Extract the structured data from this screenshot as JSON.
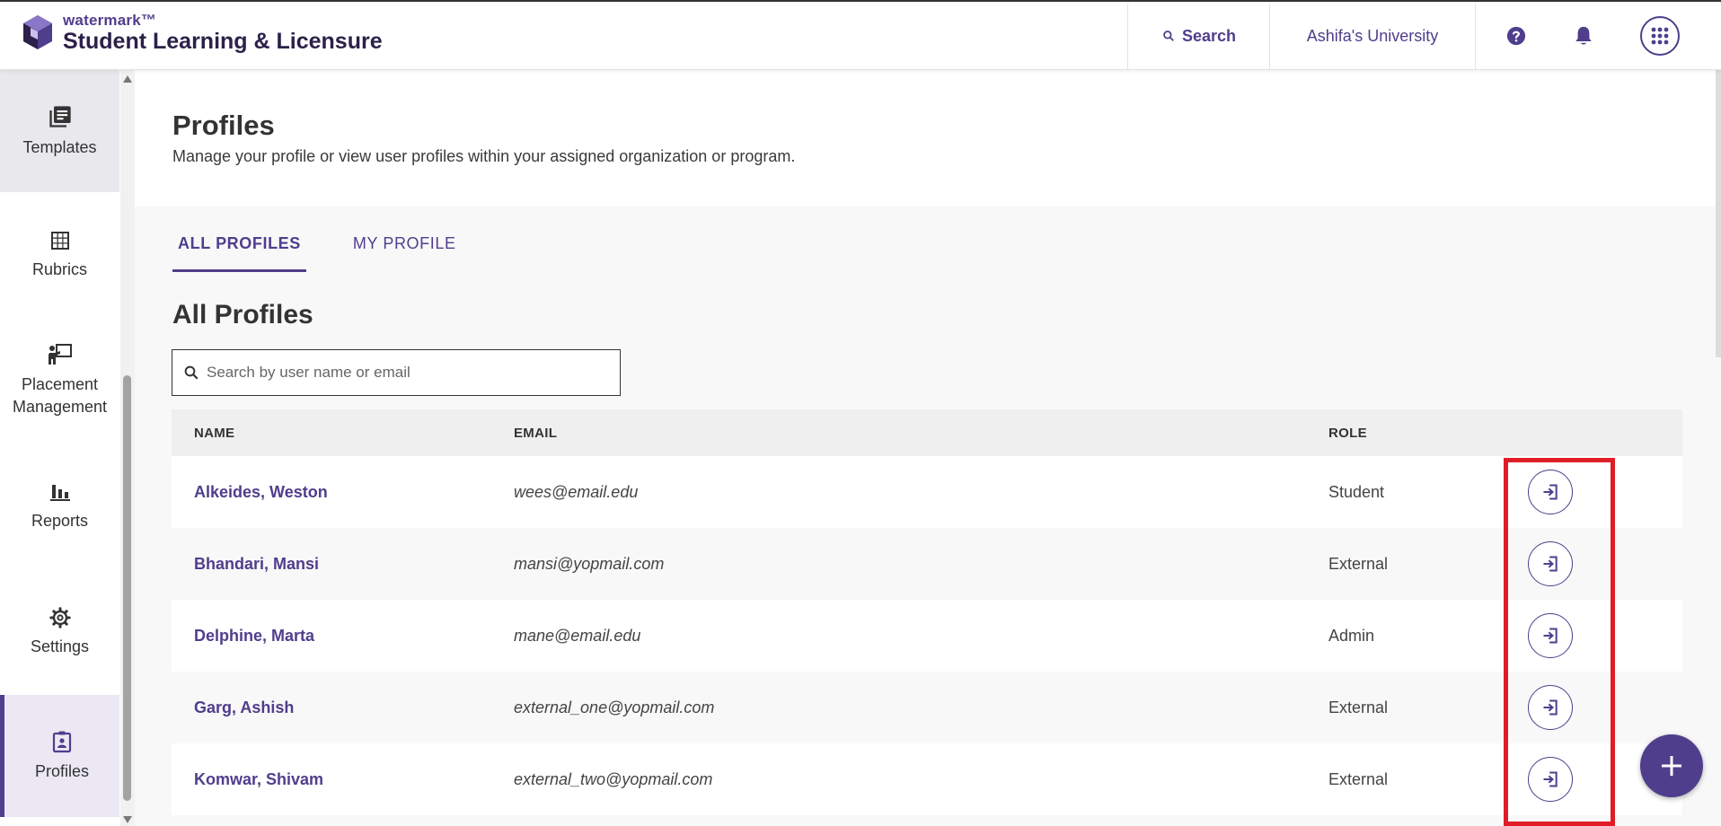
{
  "header": {
    "brand_small": "watermark™",
    "brand_big": "Student Learning & Licensure",
    "search_label": "Search",
    "university": "Ashifa's University",
    "help_icon": "help-circle-icon",
    "bell_icon": "notification-bell-icon",
    "apps_icon": "apps-grid-icon"
  },
  "sidebar": {
    "items": [
      {
        "label": "Templates",
        "icon": "templates-icon",
        "state": "hover"
      },
      {
        "label": "Rubrics",
        "icon": "grid-table-icon",
        "state": ""
      },
      {
        "label": "Placement Management",
        "icon": "placement-presenter-icon",
        "state": ""
      },
      {
        "label": "Reports",
        "icon": "bar-chart-icon",
        "state": ""
      },
      {
        "label": "Settings",
        "icon": "gear-icon",
        "state": ""
      },
      {
        "label": "Profiles",
        "icon": "profile-badge-icon",
        "state": "active"
      }
    ]
  },
  "page": {
    "title": "Profiles",
    "subtitle": "Manage your profile or view user profiles within your assigned organization or program.",
    "tabs": [
      {
        "label": "ALL PROFILES",
        "active": true
      },
      {
        "label": "MY PROFILE",
        "active": false
      }
    ],
    "section_title": "All Profiles",
    "search_placeholder": "Search by user name or email"
  },
  "table": {
    "headers": {
      "name": "NAME",
      "email": "EMAIL",
      "role": "ROLE"
    },
    "rows": [
      {
        "name": "Alkeides, Weston",
        "email": "wees@email.edu",
        "role": "Student"
      },
      {
        "name": "Bhandari, Mansi",
        "email": "mansi@yopmail.com",
        "role": "External"
      },
      {
        "name": "Delphine, Marta",
        "email": "mane@email.edu",
        "role": "Admin"
      },
      {
        "name": "Garg, Ashish",
        "email": "external_one@yopmail.com",
        "role": "External"
      },
      {
        "name": "Komwar, Shivam",
        "email": "external_two@yopmail.com",
        "role": "External"
      }
    ],
    "action_icon": "login-arrow-icon"
  },
  "fab_icon": "plus-icon",
  "colors": {
    "accent": "#4f3e8c",
    "highlight": "#e01d26"
  }
}
